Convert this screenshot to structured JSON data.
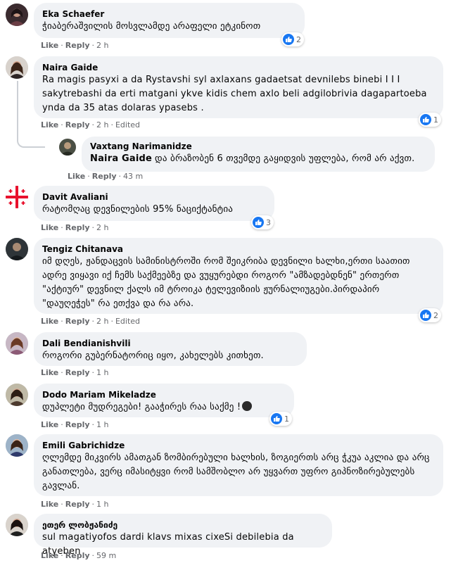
{
  "actions": {
    "like": "Like",
    "reply": "Reply",
    "edited": "Edited"
  },
  "comments": [
    {
      "author": "Eka Schaefer",
      "text": "ჭიაბერაშვილის მოსვლამდე არაფელი ეტკინოთ",
      "time": "2 h",
      "reactions": "2"
    },
    {
      "author": "Naira Gaide",
      "text": "Ra magis pasyxi a da Rystavshi syl axlaxans gadaetsat devnilebs binebi I I I sakytrebashi da erti matgani ykve kidis chem axlo beli adgilobrivia dagapartoeba ynda da 35 atas dolaras ypasebs .",
      "time": "2 h",
      "edited": true,
      "reactions": "1"
    },
    {
      "author": "Vaxtang Narimanidze",
      "mention": "Naira Gaide",
      "text": "და ბრაზობენ 6 თვემდე გაყიდვის უფლება, რომ არ აქვთ.",
      "time": "43 m"
    },
    {
      "author": "Davit Avaliani",
      "text": "რატომღაც დევნილების 95% ნაციქტანტია",
      "time": "2 h",
      "reactions": "3"
    },
    {
      "author": "Tengiz Chitanava",
      "text": "იმ დღეს, ჟანდაცვის სამინისტროში რომ შეიკრიბა დევნილი ხალხი,ერთი საათით ადრე ვიყავი იქ ჩემს საქმეებზე და ვუყურებდი როგორ \"ამზადებდნენ\" ერთერთ \"აქტიურ\" დევნილ ქალს იმ ტროიკა ტელევიზიის ჟურნალიუგები.პირდაპირ \"დაუღეჭეს\" რა ეთქვა და რა არა.",
      "time": "2 h",
      "edited": true,
      "reactions": "2"
    },
    {
      "author": "Dali Bendianishvili",
      "text": "როგორი გუბერნატორიც იყო, კახელებს კითხეთ.",
      "time": "1 h"
    },
    {
      "author": "Dodo Mariam Mikeladze",
      "text": "დუპლეტი მუდრეგები! გააჭირეს რაა საქმე !",
      "time": "1 h",
      "reactions": "1"
    },
    {
      "author": "Emili Gabrichidze",
      "text": "ღლემდე მიკვირს ამათგან ზომბირებული ხალხის, ზოგიერთს არც ჭკუა აკლია და არც განათლება, ვერც იმასიტყვი რომ სამშობლო არ უყვართ უფრო გიპნოზირებულებს გავლან.",
      "time": "1 h"
    },
    {
      "author": "ეთერ ლობჟანიძე",
      "text": "sul magatiyofos dardi klavs mixas cixeSi debilebia da atyeben",
      "time": "59 m"
    }
  ],
  "colors": {
    "bubble": "#f0f2f5",
    "like_blue": "#1877f2",
    "meta": "#65676b"
  }
}
